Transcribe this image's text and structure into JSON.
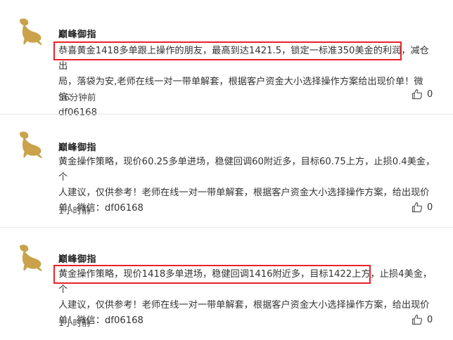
{
  "posts": [
    {
      "author": "巅峰御指",
      "content": "恭喜黄金1418多单跟上操作的朋友，最高到达1421.5，锁定一标准350美金的利润，减仓出\n局，落袋为安,老师在线一对一带单解套，根据客户资金大小选择操作方案给出现价单！微信：\ndf06168",
      "time": "36分钟前",
      "likes": "0"
    },
    {
      "author": "巅峰御指",
      "content": "黄金操作策略，现价60.25多单进场，稳健回调60附近多，目标60.75上方，止损0.4美金，个\n人建议，仅供参考！老师在线一对一带单解套，根据客户资金大小选择操作方案，给出现价\n单！微信：df06168",
      "time": "1小时前",
      "likes": "0"
    },
    {
      "author": "巅峰御指",
      "content": "黄金操作策略，现价1418多单进场，稳健回调1416附近多，目标1422上方，止损4美金，个\n人建议，仅供参考！老师在线一对一带单解套，根据客户资金大小选择操作方案，给出现价\n单！微信：df06168",
      "time": "1小时前",
      "likes": "0"
    }
  ],
  "icons": {
    "like": "thumbs-up-icon",
    "avatar": "gold-figure-logo"
  },
  "colors": {
    "highlight": "#e8222a",
    "separator": "#e6e6e6",
    "avatar_gold": "#c9a24a"
  }
}
